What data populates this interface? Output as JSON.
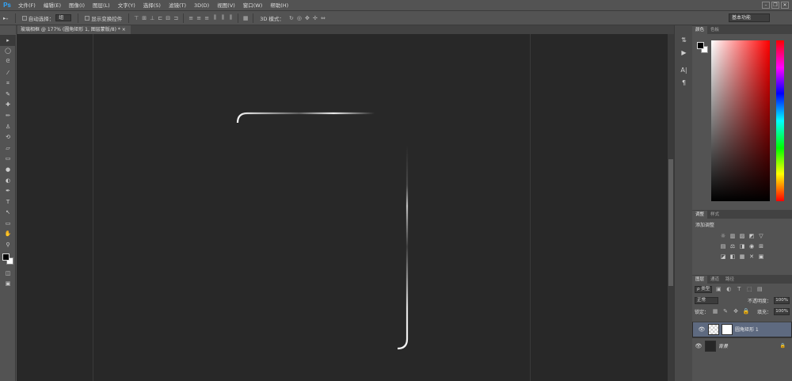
{
  "app": {
    "logo": "Ps"
  },
  "menu": [
    "文件(F)",
    "编辑(E)",
    "图像(I)",
    "图层(L)",
    "文字(Y)",
    "选择(S)",
    "滤镜(T)",
    "3D(D)",
    "视图(V)",
    "窗口(W)",
    "帮助(H)"
  ],
  "window_controls": [
    "–",
    "❐",
    "✕"
  ],
  "options": {
    "tool_glyph": "▸₊",
    "auto_select_label": "自动选择：",
    "auto_select_value": "组",
    "show_transform_label": "显示变换控件",
    "mode_label": "3D 模式：",
    "workspace": "基本功能"
  },
  "document_tab": "玻璃相框 @ 177% (圆角矩形 1, 图层蒙版/8) * ×",
  "tools": [
    "▸",
    "◯",
    "ᘓ",
    "⁄",
    "⌗",
    "✎",
    "✚",
    "✏",
    "♙",
    "⟲",
    "▱",
    "▭",
    "●",
    "◐",
    "✒",
    "T",
    "↖",
    "▭",
    "✋",
    "⚲"
  ],
  "dock_icons": [
    "⇅",
    "▶",
    "A|",
    "¶"
  ],
  "color_panel": {
    "tabs": [
      "颜色",
      "色板"
    ]
  },
  "adjust_panel": {
    "tabs": [
      "调整",
      "样式"
    ],
    "title": "添加调整",
    "row1": [
      "☼",
      "▥",
      "▨",
      "◩",
      "▽"
    ],
    "row2": [
      "▤",
      "⚖",
      "◨",
      "◉",
      "⊞"
    ],
    "row3": [
      "◪",
      "◧",
      "▦",
      "✕",
      "▣"
    ]
  },
  "layers_panel": {
    "tabs": [
      "图层",
      "通道",
      "路径"
    ],
    "filter_kind": "ρ 类型",
    "blend_mode": "正常",
    "opacity_label": "不透明度：",
    "opacity_value": "100%",
    "lock_label": "锁定：",
    "fill_label": "填充：",
    "fill_value": "100%",
    "layers": [
      {
        "name": "圆角矩形 1",
        "selected": true
      },
      {
        "name": "背景",
        "selected": false,
        "locked": true
      }
    ]
  },
  "colors": {
    "foreground": "#000000",
    "background": "#ffffff",
    "canvas": "#282828",
    "selection": "#5e6a80"
  }
}
